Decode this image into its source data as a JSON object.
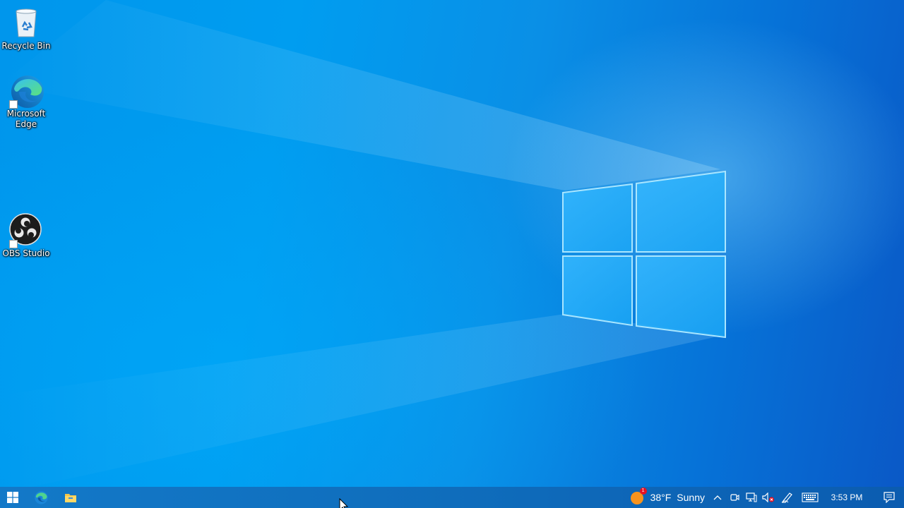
{
  "desktop": {
    "icons": [
      {
        "label": "Recycle Bin",
        "icon": "recycle-bin-icon"
      },
      {
        "label": "Microsoft Edge",
        "icon": "edge-icon"
      },
      {
        "label": "OBS Studio",
        "icon": "obs-studio-icon"
      }
    ],
    "wallpaper": {
      "name": "windows-logo-wallpaper",
      "color": "#0098EE"
    }
  },
  "taskbar": {
    "start_icon": "windows-start-icon",
    "pinned": [
      {
        "icon": "edge-icon"
      },
      {
        "icon": "file-explorer-icon"
      }
    ],
    "weather": {
      "temp": "38°F",
      "condition": "Sunny",
      "badge": "1",
      "icon": "sun-icon"
    },
    "tray_icons": [
      "chevron-up-icon",
      "meet-now-icon",
      "network-icon",
      "volume-muted-icon",
      "pen-icon",
      "keyboard-icon"
    ],
    "clock": {
      "time": "3:53 PM"
    },
    "notification_icon": "action-center-icon",
    "colors": {
      "taskbar": "#0F6DBC",
      "weather_sun": "#F7931E"
    }
  }
}
